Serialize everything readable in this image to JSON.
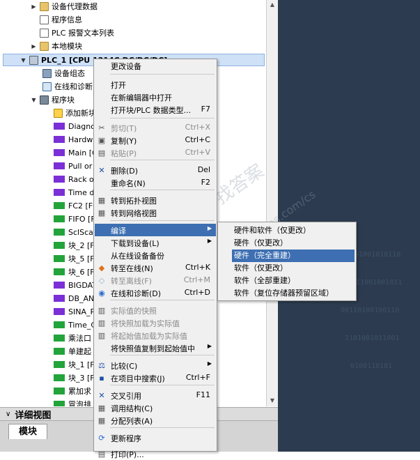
{
  "tree": {
    "items": [
      {
        "label": "设备代理数据",
        "icon": "folder-icon",
        "expander": "collapsed"
      },
      {
        "label": "程序信息",
        "icon": "program-info-icon",
        "expander": "none"
      },
      {
        "label": "PLC 报警文本列表",
        "icon": "alarm-text-icon",
        "expander": "none"
      },
      {
        "label": "本地模块",
        "icon": "folder-icon",
        "expander": "collapsed"
      },
      {
        "label": "PLC_1 [CPU 1214C DC/DC/DC]",
        "icon": "cpu-icon",
        "expander": "expanded"
      },
      {
        "label": "设备组态",
        "icon": "device-config-icon",
        "expander": "none"
      },
      {
        "label": "在线和诊断",
        "icon": "online-diagnostics-icon",
        "expander": "none"
      },
      {
        "label": "程序块",
        "icon": "program-blocks-icon",
        "expander": "expanded"
      },
      {
        "label": "添加新块",
        "icon": "add-block-icon",
        "expander": "none"
      },
      {
        "label": "Diagno",
        "icon": "block-icon",
        "expander": "none"
      },
      {
        "label": "Hardw",
        "icon": "block-icon",
        "expander": "none"
      },
      {
        "label": "Main [O",
        "icon": "block-icon",
        "expander": "none"
      },
      {
        "label": "Pull or",
        "icon": "block-icon",
        "expander": "none"
      },
      {
        "label": "Rack o",
        "icon": "block-icon",
        "expander": "none"
      },
      {
        "label": "Time d",
        "icon": "block-icon",
        "expander": "none"
      },
      {
        "label": "FC2 [FC",
        "icon": "block-icon",
        "expander": "none"
      },
      {
        "label": "FIFO [F",
        "icon": "block-icon",
        "expander": "none"
      },
      {
        "label": "SclSca",
        "icon": "block-icon",
        "expander": "none"
      },
      {
        "label": "块_2 [F",
        "icon": "block-icon",
        "expander": "none"
      },
      {
        "label": "块_5 [F",
        "icon": "block-icon",
        "expander": "none"
      },
      {
        "label": "块_6 [F",
        "icon": "block-icon",
        "expander": "none"
      },
      {
        "label": "BIGDAT",
        "icon": "block-icon",
        "expander": "none"
      },
      {
        "label": "DB_AN",
        "icon": "block-icon",
        "expander": "none"
      },
      {
        "label": "SINA_P",
        "icon": "block-icon",
        "expander": "none"
      },
      {
        "label": "Time_C",
        "icon": "block-icon",
        "expander": "none"
      },
      {
        "label": "乘法口",
        "icon": "block-icon",
        "expander": "none"
      },
      {
        "label": "单建起",
        "icon": "block-icon",
        "expander": "none"
      },
      {
        "label": "块_1 [F",
        "icon": "block-icon",
        "expander": "none"
      },
      {
        "label": "块_3 [F",
        "icon": "block-icon",
        "expander": "none"
      },
      {
        "label": "累加求",
        "icon": "block-icon",
        "expander": "none"
      },
      {
        "label": "冒泡排",
        "icon": "block-icon",
        "expander": "none"
      }
    ]
  },
  "block_colors": [
    "#7b2fd6",
    "#7b2fd6",
    "#7b2fd6",
    "#7b2fd6",
    "#7b2fd6",
    "#7b2fd6",
    "#22a43a",
    "#22a43a",
    "#22a43a",
    "#22a43a",
    "#22a43a",
    "#22a43a",
    "#7b2fd6",
    "#7b2fd6",
    "#7b2fd6",
    "#22a43a",
    "#22a43a",
    "#22a43a",
    "#22a43a",
    "#22a43a",
    "#22a43a",
    "#22a43a"
  ],
  "bottom": {
    "collapse_icon": "chevron-down-icon",
    "detail_view_label": "详细视图",
    "tab_label": "模块"
  },
  "context_menu": {
    "items": [
      {
        "label": "更改设备",
        "shortcut": "",
        "icon": "",
        "disabled": false
      },
      {
        "label": "打开",
        "shortcut": "",
        "icon": "",
        "disabled": false
      },
      {
        "label": "在新编辑器中打开",
        "shortcut": "",
        "icon": "",
        "disabled": false
      },
      {
        "label": "打开块/PLC 数据类型...",
        "shortcut": "F7",
        "icon": "",
        "disabled": false
      },
      {
        "label": "剪切(T)",
        "shortcut": "Ctrl+X",
        "icon": "scissors-icon",
        "disabled": true
      },
      {
        "label": "复制(Y)",
        "shortcut": "Ctrl+C",
        "icon": "copy-icon",
        "disabled": false
      },
      {
        "label": "粘贴(P)",
        "shortcut": "Ctrl+V",
        "icon": "paste-icon",
        "disabled": true
      },
      {
        "label": "删除(D)",
        "shortcut": "Del",
        "icon": "delete-icon",
        "disabled": false
      },
      {
        "label": "重命名(N)",
        "shortcut": "F2",
        "icon": "",
        "disabled": false
      },
      {
        "label": "转到拓扑视图",
        "shortcut": "",
        "icon": "topology-icon",
        "disabled": false
      },
      {
        "label": "转到网络视图",
        "shortcut": "",
        "icon": "network-icon",
        "disabled": false
      },
      {
        "label": "编译",
        "shortcut": "",
        "icon": "",
        "disabled": false,
        "submenu": true
      },
      {
        "label": "下载到设备(L)",
        "shortcut": "",
        "icon": "",
        "disabled": false,
        "submenu": true
      },
      {
        "label": "从在线设备备份",
        "shortcut": "",
        "icon": "",
        "disabled": false
      },
      {
        "label": "转至在线(N)",
        "shortcut": "Ctrl+K",
        "icon": "go-online-icon",
        "disabled": false
      },
      {
        "label": "转至离线(F)",
        "shortcut": "Ctrl+M",
        "icon": "go-offline-icon",
        "disabled": true
      },
      {
        "label": "在线和诊断(D)",
        "shortcut": "Ctrl+D",
        "icon": "diagnostics-icon",
        "disabled": false
      },
      {
        "label": "实际值的快照",
        "shortcut": "",
        "icon": "snapshot-icon",
        "disabled": true
      },
      {
        "label": "将快照加载为实际值",
        "shortcut": "",
        "icon": "load-snapshot-icon",
        "disabled": true
      },
      {
        "label": "将起始值加载为实际值",
        "shortcut": "",
        "icon": "load-start-icon",
        "disabled": true
      },
      {
        "label": "将快照值复制到起始值中",
        "shortcut": "",
        "icon": "",
        "disabled": false,
        "submenu": true
      },
      {
        "label": "比较(C)",
        "shortcut": "",
        "icon": "compare-icon",
        "disabled": false,
        "submenu": true
      },
      {
        "label": "在项目中搜索(J)",
        "shortcut": "Ctrl+F",
        "icon": "search-icon",
        "disabled": false
      },
      {
        "label": "交叉引用",
        "shortcut": "F11",
        "icon": "cross-reference-icon",
        "disabled": false
      },
      {
        "label": "调用结构(C)",
        "shortcut": "",
        "icon": "call-structure-icon",
        "disabled": false
      },
      {
        "label": "分配列表(A)",
        "shortcut": "",
        "icon": "assignment-list-icon",
        "disabled": false
      },
      {
        "label": "更新程序",
        "shortcut": "",
        "icon": "update-program-icon",
        "disabled": false
      },
      {
        "label": "打印(P)...",
        "shortcut": "",
        "icon": "print-icon",
        "disabled": false
      }
    ]
  },
  "compile_submenu": {
    "items": [
      {
        "label": "硬件和软件（仅更改）"
      },
      {
        "label": "硬件（仅更改）"
      },
      {
        "label": "硬件（完全重建）"
      },
      {
        "label": "软件（仅更改）"
      },
      {
        "label": "软件（全部重建）"
      },
      {
        "label": "软件（复位存储器预留区域）"
      }
    ]
  },
  "watermark": {
    "text_1": "找答案",
    "text_2": "support.industry.siemens.com/cs",
    "text_3": "工业"
  },
  "colors": {
    "menu_highlight": "#3d6fb2",
    "tree_selection": "#cfe1f7",
    "background_dark": "#2c3b4f"
  }
}
